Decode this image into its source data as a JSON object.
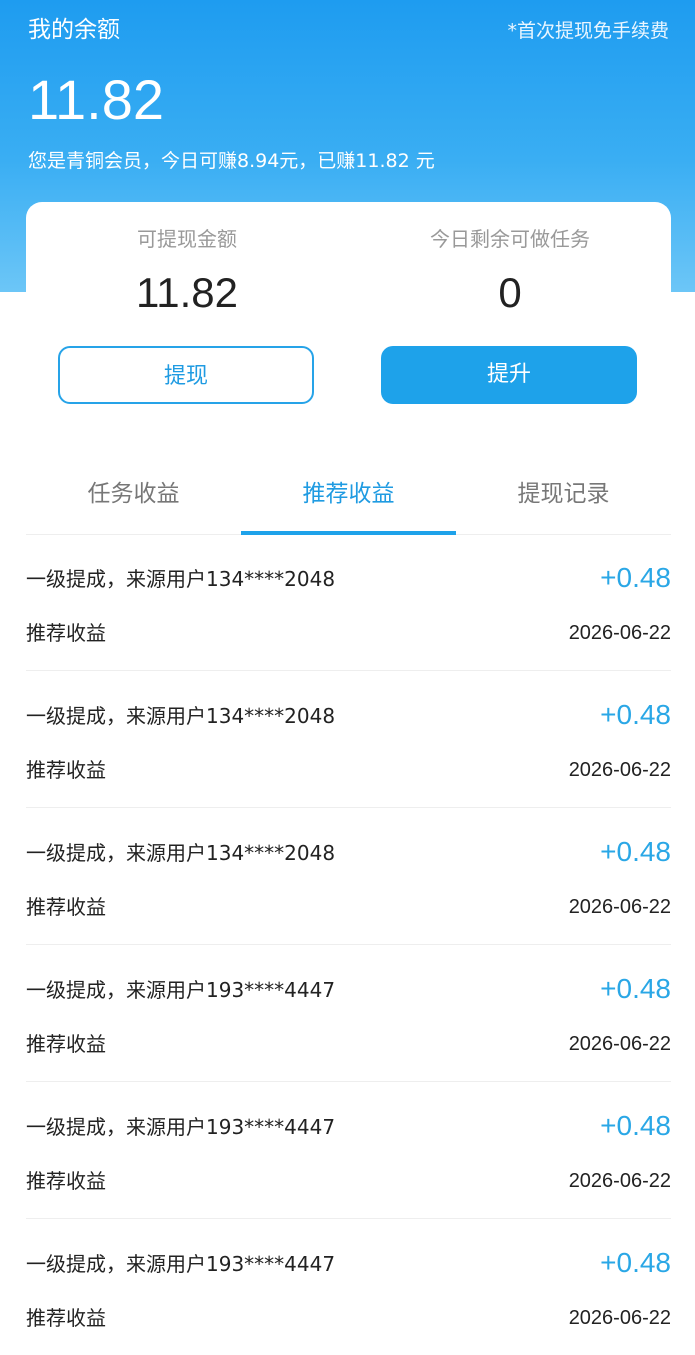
{
  "header": {
    "title": "我的余额",
    "note": "*首次提现免手续费",
    "balance": "11.82",
    "member_line": "您是青铜会员，今日可赚8.94元，已赚11.82 元"
  },
  "summary": {
    "withdrawable_label": "可提现金额",
    "withdrawable_value": "11.82",
    "remaining_tasks_label": "今日剩余可做任务",
    "remaining_tasks_value": "0",
    "withdraw_button": "提现",
    "upgrade_button": "提升"
  },
  "tabs": [
    {
      "label": "任务收益",
      "active": false
    },
    {
      "label": "推荐收益",
      "active": true
    },
    {
      "label": "提现记录",
      "active": false
    }
  ],
  "records": [
    {
      "title": "一级提成，来源用户134****2048",
      "amount": "+0.48",
      "type": "推荐收益",
      "date": "2026-06-22"
    },
    {
      "title": "一级提成，来源用户134****2048",
      "amount": "+0.48",
      "type": "推荐收益",
      "date": "2026-06-22"
    },
    {
      "title": "一级提成，来源用户134****2048",
      "amount": "+0.48",
      "type": "推荐收益",
      "date": "2026-06-22"
    },
    {
      "title": "一级提成，来源用户193****4447",
      "amount": "+0.48",
      "type": "推荐收益",
      "date": "2026-06-22"
    },
    {
      "title": "一级提成，来源用户193****4447",
      "amount": "+0.48",
      "type": "推荐收益",
      "date": "2026-06-22"
    },
    {
      "title": "一级提成，来源用户193****4447",
      "amount": "+0.48",
      "type": "推荐收益",
      "date": "2026-06-22"
    }
  ],
  "colors": {
    "accent": "#1ea2ea",
    "amount": "#2aa7e6",
    "header_top": "#1e9cf0",
    "header_bottom": "#6cc6f7"
  }
}
